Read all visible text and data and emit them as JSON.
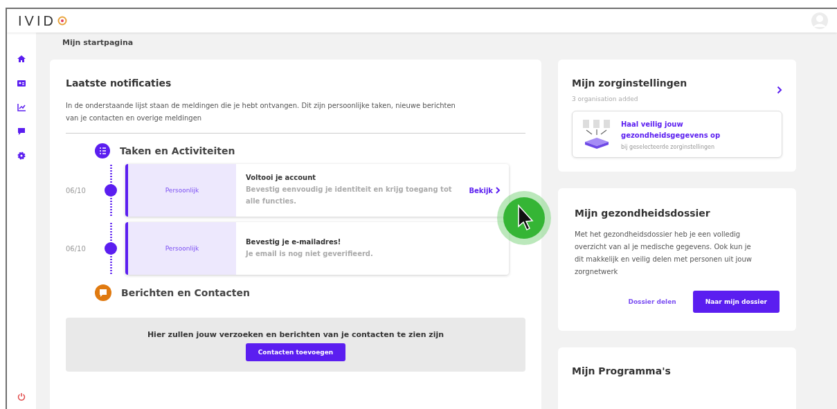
{
  "header": {
    "logo": "IVID"
  },
  "page_title": "Mijn startpagina",
  "notifications": {
    "title": "Laatste notificaties",
    "intro": "In de onderstaande lijst staan de meldingen die je hebt ontvangen. Dit zijn persoonlijke taken, nieuwe berichten van je contacten en overige meldingen",
    "sections": [
      {
        "kind": "tasks",
        "title": "Taken en Activiteiten",
        "items": [
          {
            "date": "06/10",
            "tag": "Persoonlijk",
            "title": "Voltooi je account",
            "text": "Bevestig eenvoudig je identiteit en krijg toegang tot alle functies.",
            "action": "Bekijk"
          },
          {
            "date": "06/10",
            "tag": "Persoonlijk",
            "title": "Bevestig je e-mailadres!",
            "text": "Je email is nog niet geverifieerd."
          }
        ]
      },
      {
        "kind": "messages",
        "title": "Berichten en Contacten",
        "empty_text": "Hier zullen jouw verzoeken en berichten van je contacten te zien zijn",
        "button": "Contacten toevoegen"
      }
    ]
  },
  "care": {
    "title": "Mijn zorginstellingen",
    "subtitle": "3 organisation added",
    "promo_title": "Haal veilig jouw gezondheidsgegevens op",
    "promo_text": "bij geselecteerde zorginstellingen"
  },
  "dossier": {
    "title": "Mijn gezondheidsdossier",
    "text": "Met het gezondheidsdossier heb je een volledig overzicht van al je medische gegevens. Ook kun je dit makkelijk en veilig delen met personen uit jouw zorgnetwerk",
    "link": "Dossier delen",
    "button": "Naar mijn dossier"
  },
  "programs": {
    "title": "Mijn Programma's"
  }
}
